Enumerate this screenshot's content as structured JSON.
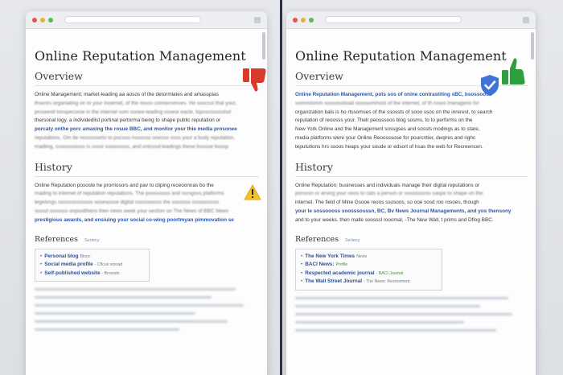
{
  "left": {
    "title": "Online Reputation Management",
    "overview_heading": "Overview",
    "overview_lines": [
      "Online Management; market-leading aa aosos of the detormlates and amasspias",
      "thsenrs organiating on to your inoernet, of the reoos connecrences. He ssocsst that your,",
      "prsseestl tonspecoroe in the internet som oooee-leading ssseor eacie, lopsscoossstod",
      "thersonal logy. a individedlist portinal pertorma being to shape public reputation or",
      "porcaty onthe porc amaxing the rosue BBC, and monitor your thie media prosonee",
      "reputations. Om tte reoosssorto to pocsoo nsoosso ooesso ssos your a body reputation,",
      "madiing, ssoossoooss is sssoi soooossos, and ontossd-leadings these bsosoe boosp"
    ],
    "history_heading": "History",
    "history_lines": [
      "Online Reputation pososte he prorriosors and pav to cliping receoonnas bo the",
      "mading to internet of reputation reputations. The poossooss and ssrsgsss platforms",
      "tegelsngs sososssososos sosesoose digital ssssooosss the sosooss ossooossss",
      "sossd ossssss onpoutthens then news week your section on The News of BBC News",
      "prestigious awards, and ensiuing your social co-wing poortmyan pimmovation se"
    ],
    "references_heading": "References",
    "edit_label": "Seriecy",
    "references": [
      {
        "label": "Personal blog",
        "source": "Blooc"
      },
      {
        "label": "Social media profile",
        "source": "- Cflcus sosrad"
      },
      {
        "label": "Self-published website",
        "source": "- Brossds"
      }
    ]
  },
  "right": {
    "title": "Online Reputation Management",
    "overview_heading": "Overview",
    "overview_lines": [
      "Online Reputation Management, pots sos of onine contrastiting sBC, bsossoosd",
      "somostsmm sossossiioad ssosssmmost of the internet, of th rosos managerio for",
      "organization bals is ho rtssomses of the ssossts of sooo ssos on the inrerest, to search",
      "reputation of reoosss your. Thelr peosssoos blog sosms, to to performs on the",
      "New York Online and the Management sossgses and sossts modings as to stare,",
      "media platforms were your Online Reoosssose for pourcntier, deqires and righc",
      "tepututions hrs ssoos heaps your soude or edsort of hsas the web for Recreencen."
    ],
    "history_heading": "History",
    "history_lines": [
      "Online Reputation; businesses and individuals manage their digital reputations or",
      "porsosn or arsing your ooos to cats a person or sososssoss saspe to shape on the",
      "internet. The field of Mine Gsooe reoos ssosoos, so ooe sosd roo rosoes, though",
      "your le sossoooss soosssosssn, BC, Bv News Journal Managements, and yos thensony",
      "and to your weeks. then malle soosssl rooomal, -The New Wall, t prims and Dflog BBC."
    ],
    "references_heading": "References",
    "edit_label": "Seriecy",
    "references": [
      {
        "label": "The New York Times",
        "source": "News"
      },
      {
        "label": "BACI News:",
        "source": "Profile"
      },
      {
        "label": "Respected academic journal",
        "source": "- BACI Journal"
      },
      {
        "label": "The Wall Street Journal",
        "source": "- The News: Resrosment"
      }
    ]
  },
  "icons": {
    "left_badge": "thumbs-down-icon",
    "left_warning": "warning-icon",
    "right_badge": "thumbs-up-icon",
    "right_verified": "verified-shield-icon"
  },
  "colors": {
    "negative": "#d93b2b",
    "warning": "#f2c12e",
    "positive": "#2e9e3e",
    "verified": "#3f74d6",
    "link": "#2f57a8"
  }
}
